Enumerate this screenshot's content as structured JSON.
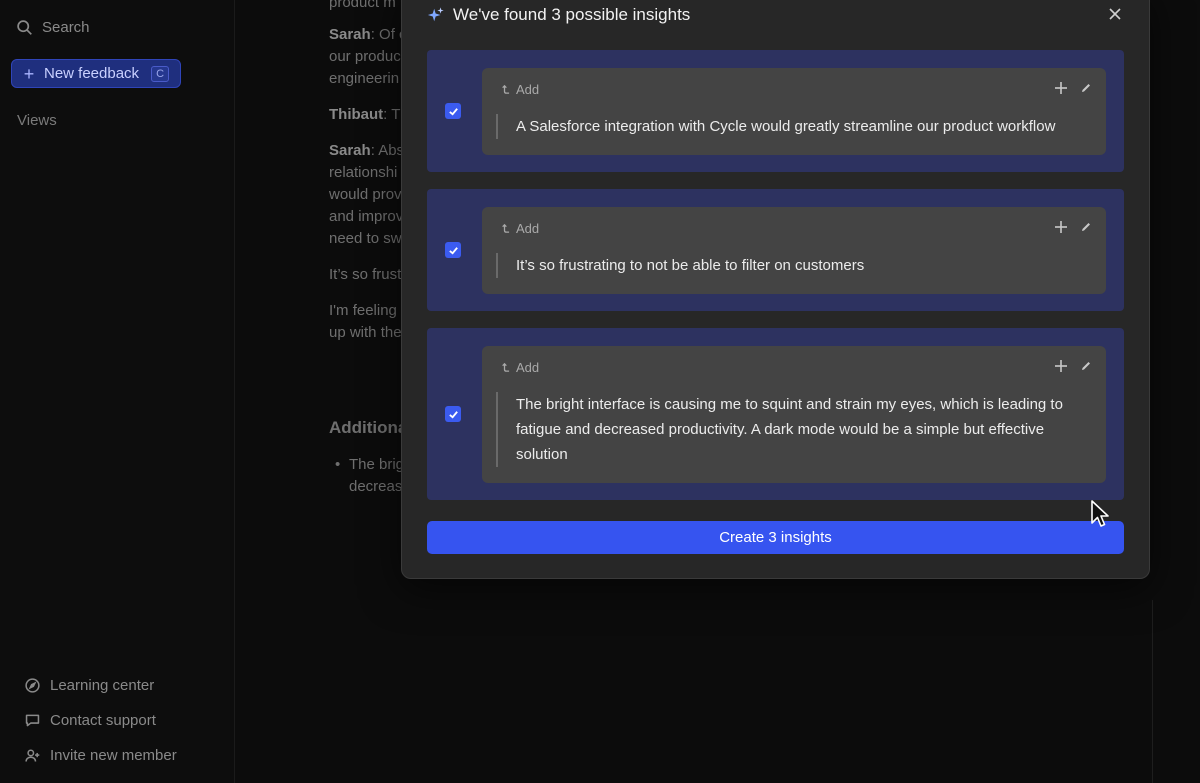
{
  "sidebar": {
    "search_label": "Search",
    "new_feedback_label": "New feedback",
    "new_feedback_shortcut": "C",
    "views_label": "Views",
    "bottom_items": [
      {
        "label": "Learning center",
        "icon": "compass-icon"
      },
      {
        "label": "Contact support",
        "icon": "chat-bubble-icon"
      },
      {
        "label": "Invite new member",
        "icon": "user-plus-icon"
      }
    ]
  },
  "document": {
    "line1": "product m",
    "sarah1_name": "Sarah",
    "sarah1_l1": ": Of c",
    "sarah1_l2": "our produc",
    "sarah1_l3": "engineerin",
    "thibaut_name": "Thibaut",
    "thibaut_text": ": T",
    "sarah2_name": "Sarah",
    "sarah2_l1": ": Abs",
    "sarah2_l2": "relationshi",
    "sarah2_l3": "would prov",
    "sarah2_l4": "and improv",
    "sarah2_l5": "need to sw",
    "frust": "It’s so frust",
    "feeling_l1": "I'm feeling",
    "feeling_l2": "up with the",
    "heading": "Additiona",
    "bullet_l1": "The brig",
    "bullet_l2": "decreas"
  },
  "modal": {
    "title": "We've found 3 possible insights",
    "insights": [
      {
        "checked": true,
        "add_label": "Add",
        "text": "A Salesforce integration with Cycle would greatly streamline our product workflow"
      },
      {
        "checked": true,
        "add_label": "Add",
        "text": "It’s so frustrating to not be able to filter on customers"
      },
      {
        "checked": true,
        "add_label": "Add",
        "text": "The bright interface is causing me to squint and strain my eyes, which is leading to fatigue and decreased productivity. A dark mode would be a simple but effective solution"
      }
    ],
    "create_button_label": "Create 3 insights"
  },
  "colors": {
    "accent": "#3654f0",
    "insight_bg": "#2d3260",
    "card_bg": "#444444",
    "modal_bg": "#272727"
  }
}
